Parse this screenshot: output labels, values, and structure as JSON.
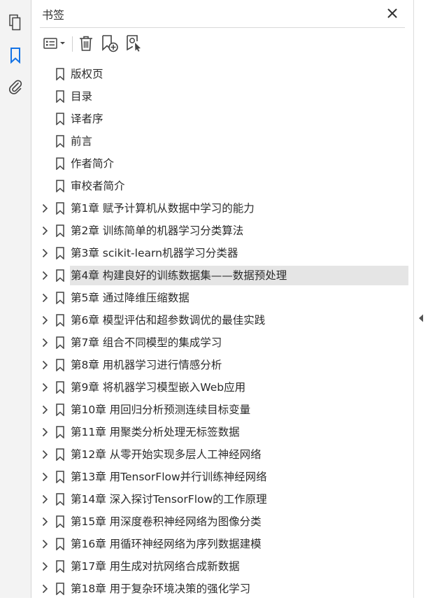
{
  "panel": {
    "title": "书签",
    "icons": {
      "close": "close-icon",
      "options": "options-menu-icon",
      "delete": "trash-icon",
      "new_bookmark": "add-bookmark-icon",
      "find_bookmark": "find-current-bookmark-icon"
    }
  },
  "sidebar": {
    "icons": [
      "pages-thumbnails-icon",
      "bookmarks-icon",
      "attachments-icon"
    ],
    "active": "bookmarks-icon"
  },
  "bookmarks": [
    {
      "label": "版权页",
      "expandable": false
    },
    {
      "label": "目录",
      "expandable": false
    },
    {
      "label": "译者序",
      "expandable": false
    },
    {
      "label": "前言",
      "expandable": false
    },
    {
      "label": "作者简介",
      "expandable": false
    },
    {
      "label": "审校者简介",
      "expandable": false
    },
    {
      "label": "第1章 赋予计算机从数据中学习的能力",
      "expandable": true
    },
    {
      "label": "第2章 训练简单的机器学习分类算法",
      "expandable": true
    },
    {
      "label": "第3章 scikit-learn机器学习分类器",
      "expandable": true
    },
    {
      "label": "第4章 构建良好的训练数据集——数据预处理",
      "expandable": true,
      "selected": true
    },
    {
      "label": "第5章 通过降维压缩数据",
      "expandable": true
    },
    {
      "label": "第6章 模型评估和超参数调优的最佳实践",
      "expandable": true
    },
    {
      "label": "第7章 组合不同模型的集成学习",
      "expandable": true
    },
    {
      "label": "第8章 用机器学习进行情感分析",
      "expandable": true
    },
    {
      "label": "第9章 将机器学习模型嵌入Web应用",
      "expandable": true
    },
    {
      "label": "第10章 用回归分析预测连续目标变量",
      "expandable": true
    },
    {
      "label": "第11章 用聚类分析处理无标签数据",
      "expandable": true
    },
    {
      "label": "第12章 从零开始实现多层人工神经网络",
      "expandable": true
    },
    {
      "label": "第13章 用TensorFlow并行训练神经网络",
      "expandable": true
    },
    {
      "label": "第14章 深入探讨TensorFlow的工作原理",
      "expandable": true
    },
    {
      "label": "第15章 用深度卷积神经网络为图像分类",
      "expandable": true
    },
    {
      "label": "第16章 用循环神经网络为序列数据建模",
      "expandable": true
    },
    {
      "label": "第17章 用生成对抗网络合成新数据",
      "expandable": true
    },
    {
      "label": "第18章 用于复杂环境决策的强化学习",
      "expandable": true
    }
  ],
  "colors": {
    "active_icon": "#1473e6",
    "icon": "#444444",
    "selected_row": "#e5e5e5"
  }
}
